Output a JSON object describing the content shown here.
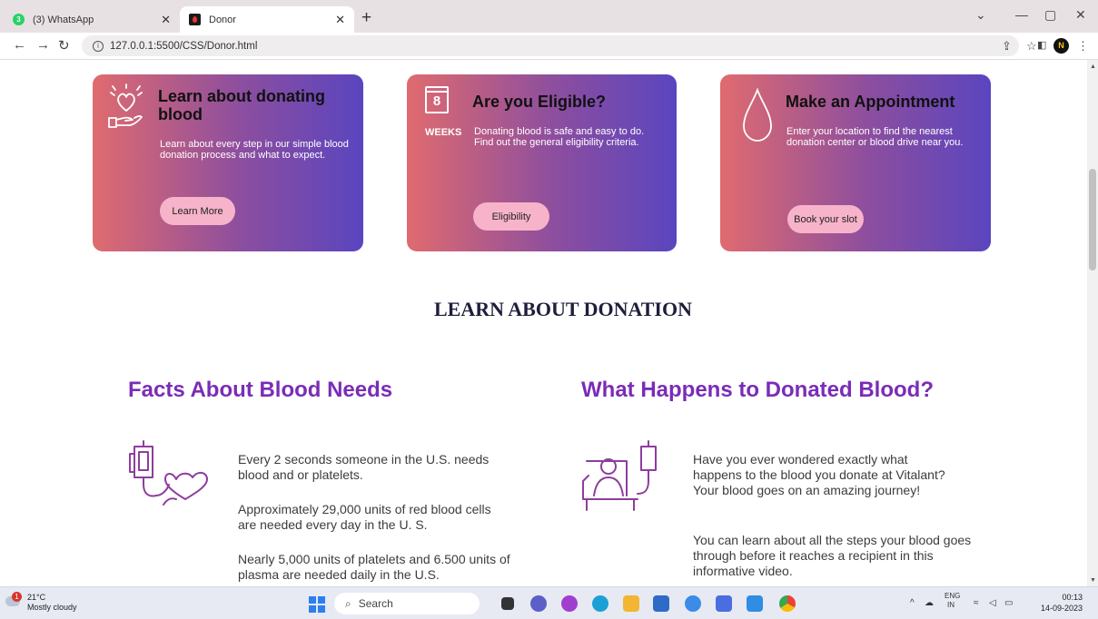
{
  "browser": {
    "tabs": [
      {
        "label": "(3) WhatsApp",
        "badge": "3"
      },
      {
        "label": "Donor"
      }
    ],
    "url": "127.0.0.1:5500/CSS/Donor.html"
  },
  "cards": [
    {
      "title": "Learn about donating blood",
      "description": "Learn about every step in our simple blood donation process and what to expect.",
      "button": "Learn More",
      "icon": "hand-heart-icon"
    },
    {
      "title": "Are you Eligible?",
      "description": "Donating blood is safe and easy to do. Find out the general eligibility criteria.",
      "button": "Eligibility",
      "icon": "calendar-8-weeks-icon",
      "calendar_number": "8",
      "calendar_caption": "WEEKS"
    },
    {
      "title": "Make an Appointment",
      "description": "Enter your location to find the nearest donation center or blood drive near you.",
      "button": "Book your slot",
      "icon": "blood-drop-icon"
    }
  ],
  "section_title": "LEARN ABOUT DONATION",
  "columns": {
    "left": {
      "title": "Facts About Blood Needs",
      "icon": "blood-bag-heart-icon",
      "paragraphs": [
        "Every 2 seconds someone in the U.S. needs blood and or platelets.",
        "Approximately 29,000 units of red blood cells are needed every day in the U. S.",
        "Nearly 5,000 units of platelets and 6.500 units of plasma are needed daily in the U.S."
      ]
    },
    "right": {
      "title": "What Happens to Donated Blood?",
      "icon": "patient-transfusion-icon",
      "paragraphs": [
        "Have you ever wondered exactly what happens to the blood you donate at Vitalant? Your blood goes on an amazing journey!",
        "You can learn about all the steps your blood goes through before it reaches a recipient in this informative video."
      ]
    }
  },
  "taskbar": {
    "weather_temp": "21°C",
    "weather_desc": "Mostly cloudy",
    "weather_badge": "1",
    "search_placeholder": "Search",
    "lang_line1": "ENG",
    "lang_line2": "IN",
    "time": "00:13",
    "date": "14-09-2023"
  },
  "colors": {
    "card_gradient_start": "#e06b6f",
    "card_gradient_end": "#5a45bf",
    "button_pink": "#f7b3c9",
    "heading_purple": "#7a2cb7",
    "section_title_navy": "#1e1e3c"
  }
}
